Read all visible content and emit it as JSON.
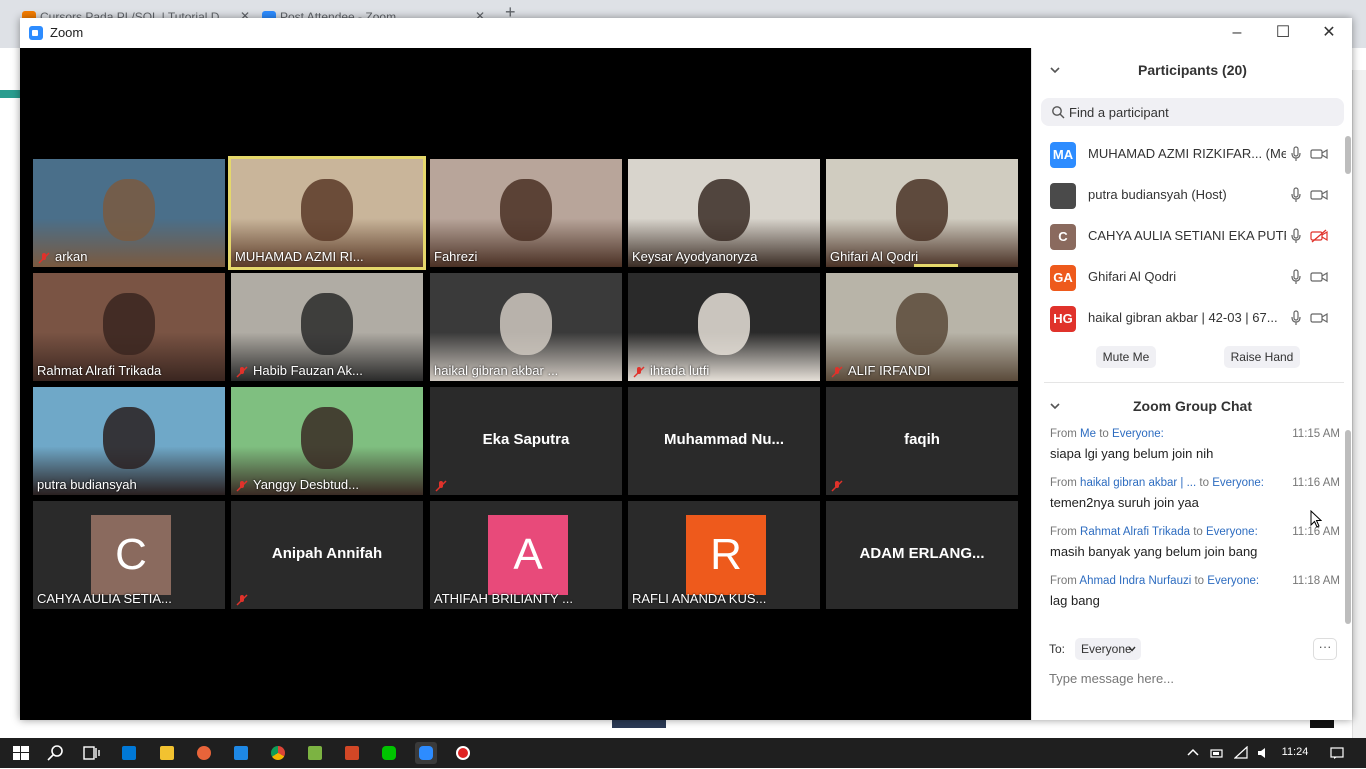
{
  "browser": {
    "tabs": [
      {
        "label": "Cursors Pada PL/SQL | Tutorial D...",
        "icon": "blogger-icon"
      },
      {
        "label": "Post Attendee - Zoom",
        "icon": "zoom-icon"
      }
    ]
  },
  "window": {
    "title": "Zoom",
    "minimize": "–",
    "maximize": "☐",
    "close": "✕"
  },
  "tiles": [
    {
      "name": "arkan",
      "type": "cam",
      "muted": true
    },
    {
      "name": "MUHAMAD AZMI RI...",
      "type": "cam",
      "muted": false,
      "active": true
    },
    {
      "name": "Fahrezi",
      "type": "cam",
      "muted": false
    },
    {
      "name": "Keysar Ayodyanoryza",
      "type": "cam",
      "muted": false
    },
    {
      "name": "Ghifari Al Qodri",
      "type": "cam",
      "muted": false,
      "speaking": true
    },
    {
      "name": "Rahmat Alrafi Trikada",
      "type": "cam",
      "muted": false
    },
    {
      "name": "Habib Fauzan Ak...",
      "type": "cam",
      "muted": true
    },
    {
      "name": "haikal gibran akbar ...",
      "type": "cam",
      "muted": false
    },
    {
      "name": "ihtada lutfi",
      "type": "cam",
      "muted": true
    },
    {
      "name": "ALIF IRFANDI",
      "type": "cam",
      "muted": true
    },
    {
      "name": "putra budiansyah",
      "type": "cam",
      "muted": false
    },
    {
      "name": "Yanggy Desbtud...",
      "type": "cam",
      "muted": true
    },
    {
      "name": "Eka Saputra",
      "type": "nocam",
      "muted": true
    },
    {
      "name": "Muhammad  Nu...",
      "type": "nocam",
      "muted": false
    },
    {
      "name": "faqih",
      "type": "nocam",
      "muted": true
    },
    {
      "name": "CAHYA AULIA SETIA...",
      "type": "avatar",
      "letter": "C",
      "color": "#8a6a5e",
      "muted": false
    },
    {
      "name": "Anipah Annifah",
      "type": "nocam",
      "muted": true
    },
    {
      "name": "ATHIFAH BRILIANTY ...",
      "type": "avatar",
      "letter": "A",
      "color": "#e84a7a",
      "muted": false
    },
    {
      "name": "RAFLI ANANDA KUS...",
      "type": "avatar",
      "letter": "R",
      "color": "#ee5a1c",
      "muted": false
    },
    {
      "name": "ADAM ERLANG...",
      "type": "nocam",
      "muted": false
    }
  ],
  "participants": {
    "title": "Participants (20)",
    "search_placeholder": "Find a participant",
    "list": [
      {
        "initials": "MA",
        "color": "#2d8cff",
        "name": "MUHAMAD AZMI RIZKIFAR... (Me)",
        "mic": "on",
        "cam": "on"
      },
      {
        "initials": "",
        "color": "#4a4a4a",
        "name": "putra budiansyah (Host)",
        "mic": "on",
        "cam": "on"
      },
      {
        "initials": "C",
        "color": "#8a6a5e",
        "name": "CAHYA AULIA SETIANI EKA PUTRI",
        "mic": "on",
        "cam": "off"
      },
      {
        "initials": "GA",
        "color": "#ee5a1c",
        "name": "Ghifari Al Qodri",
        "mic": "on",
        "cam": "on"
      },
      {
        "initials": "HG",
        "color": "#e0322b",
        "name": "haikal gibran akbar | 42-03 | 67...",
        "mic": "on",
        "cam": "on"
      }
    ],
    "mute_me": "Mute Me",
    "raise_hand": "Raise Hand"
  },
  "chat": {
    "title": "Zoom Group Chat",
    "messages": [
      {
        "from_prefix": "From",
        "from": "Me",
        "to_word": "to",
        "to": "Everyone:",
        "time": "11:15 AM",
        "text": "siapa lgi yang belum join nih"
      },
      {
        "from_prefix": "From",
        "from": "haikal gibran akbar | ...",
        "to_word": "to",
        "to": "Everyone:",
        "time": "11:16 AM",
        "text": "temen2nya suruh join yaa"
      },
      {
        "from_prefix": "From",
        "from": "Rahmat Alrafi Trikada",
        "to_word": "to",
        "to": "Everyone:",
        "time": "11:16 AM",
        "text": "masih banyak yang belum join bang"
      },
      {
        "from_prefix": "From",
        "from": "Ahmad Indra Nurfauzi",
        "to_word": "to",
        "to": "Everyone:",
        "time": "11:18 AM",
        "text": "lag bang"
      }
    ],
    "to_label": "To:",
    "to_value": "Everyone",
    "more": "···",
    "input_placeholder": "Type message here..."
  },
  "taskbar": {
    "clock": "11:24"
  }
}
